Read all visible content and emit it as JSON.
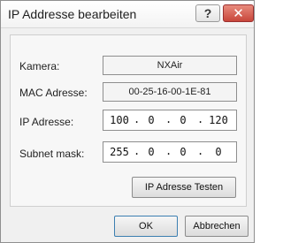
{
  "window": {
    "title": "IP Addresse bearbeiten",
    "help_icon": "?",
    "close_icon": "✕"
  },
  "form": {
    "camera_label": "Kamera:",
    "camera_value": "NXAir",
    "mac_label": "MAC Adresse:",
    "mac_value": "00-25-16-00-1E-81",
    "ip_label": "IP Adresse:",
    "ip_octets": [
      "100",
      "0",
      "0",
      "120"
    ],
    "subnet_label": "Subnet mask:",
    "subnet_octets": [
      "255",
      "0",
      "0",
      "0"
    ],
    "dot": ".",
    "test_button": "IP Adresse Testen"
  },
  "footer": {
    "ok_button": "OK",
    "cancel_button": "Abbrechen"
  }
}
